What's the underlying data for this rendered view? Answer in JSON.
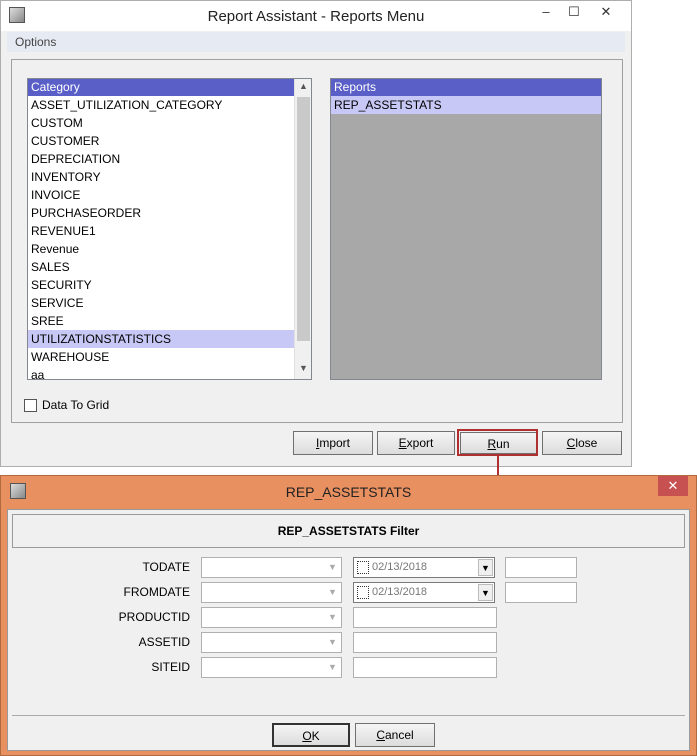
{
  "main_window": {
    "title": "Report Assistant - Reports Menu",
    "minimize": "–",
    "maximize": "☐",
    "close": "✕",
    "menu": [
      "Options"
    ],
    "category_list": {
      "header": "Category",
      "items": [
        "ASSET_UTILIZATION_CATEGORY",
        "CUSTOM",
        "CUSTOMER",
        "DEPRECIATION",
        "INVENTORY",
        "INVOICE",
        "PURCHASEORDER",
        "REVENUE1",
        "Revenue",
        "SALES",
        "SECURITY",
        "SERVICE",
        "SREE",
        "UTILIZATIONSTATISTICS",
        "WAREHOUSE",
        "aa"
      ],
      "selected": "UTILIZATIONSTATISTICS"
    },
    "reports_list": {
      "header": "Reports",
      "items": [
        "REP_ASSETSTATS"
      ],
      "selected": "REP_ASSETSTATS"
    },
    "data_to_grid_label": "Data To Grid",
    "data_to_grid_checked": false,
    "buttons": {
      "import": {
        "label": "mport",
        "accel": "I"
      },
      "export": {
        "label": "xport",
        "accel": "E"
      },
      "run": {
        "label": "un",
        "accel": "R"
      },
      "close": {
        "label": "lose",
        "accel": "C"
      }
    }
  },
  "filter_window": {
    "title": "REP_ASSETSTATS",
    "close": "✕",
    "header": "REP_ASSETSTATS Filter",
    "fields": [
      {
        "label": "TODATE",
        "date": "02/13/2018"
      },
      {
        "label": "FROMDATE",
        "date": "02/13/2018"
      },
      {
        "label": "PRODUCTID"
      },
      {
        "label": "ASSETID"
      },
      {
        "label": "SITEID"
      }
    ],
    "ok": {
      "label": "K",
      "accel": "O"
    },
    "cancel": {
      "label": "ancel",
      "accel": "C"
    }
  },
  "colors": {
    "accent_header": "#5a5fc8",
    "selection": "#c8c8f6",
    "filter_frame": "#e99060",
    "highlight": "#b03030"
  }
}
